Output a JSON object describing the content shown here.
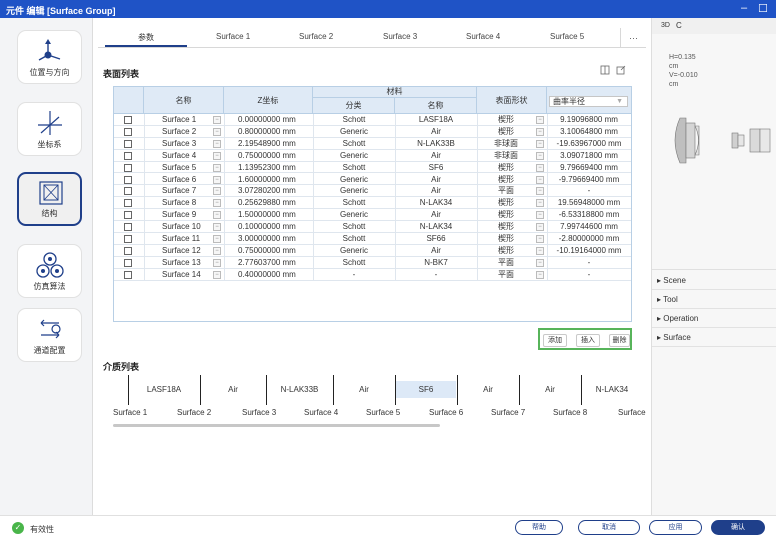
{
  "window": {
    "title": "元件 编辑 [Surface Group]",
    "minimize": "–",
    "restore": "☐"
  },
  "sidebar": {
    "items": [
      {
        "label": "位置与方向",
        "icon": "position-icon"
      },
      {
        "label": "坐标系",
        "icon": "coordinate-icon"
      },
      {
        "label": "结构",
        "icon": "structure-icon",
        "active": true
      },
      {
        "label": "仿真算法",
        "icon": "simulation-icon"
      },
      {
        "label": "通道配置",
        "icon": "channel-icon"
      }
    ]
  },
  "tabs": [
    "参数",
    "Surface 1",
    "Surface 2",
    "Surface 3",
    "Surface 4",
    "Surface 5"
  ],
  "tabs_more": "···",
  "surface_table": {
    "title": "表面列表",
    "headers": {
      "name": "名称",
      "z": "Z坐标",
      "material": "材料",
      "category": "分类",
      "material_name": "名称",
      "shape": "表面形状"
    },
    "radius_select": "曲率半径",
    "rows": [
      {
        "name": "Surface 1",
        "z": "0.00000000 mm",
        "category": "Schott",
        "material": "LASF18A",
        "shape": "楔形",
        "radius": "9.19096800 mm"
      },
      {
        "name": "Surface 2",
        "z": "0.80000000 mm",
        "category": "Generic",
        "material": "Air",
        "shape": "楔形",
        "radius": "3.10064800 mm"
      },
      {
        "name": "Surface 3",
        "z": "2.19548900 mm",
        "category": "Schott",
        "material": "N-LAK33B",
        "shape": "非球面",
        "radius": "-19.63967000 mm"
      },
      {
        "name": "Surface 4",
        "z": "0.75000000 mm",
        "category": "Generic",
        "material": "Air",
        "shape": "非球面",
        "radius": "3.09071800 mm"
      },
      {
        "name": "Surface 5",
        "z": "1.13952300 mm",
        "category": "Schott",
        "material": "SF6",
        "shape": "楔形",
        "radius": "9.79669400 mm"
      },
      {
        "name": "Surface 6",
        "z": "1.60000000 mm",
        "category": "Generic",
        "material": "Air",
        "shape": "楔形",
        "radius": "-9.79669400 mm"
      },
      {
        "name": "Surface 7",
        "z": "3.07280200 mm",
        "category": "Generic",
        "material": "Air",
        "shape": "平面",
        "radius": "-"
      },
      {
        "name": "Surface 8",
        "z": "0.25629880 mm",
        "category": "Schott",
        "material": "N-LAK34",
        "shape": "楔形",
        "radius": "19.56948000 mm"
      },
      {
        "name": "Surface 9",
        "z": "1.50000000 mm",
        "category": "Generic",
        "material": "Air",
        "shape": "楔形",
        "radius": "-6.53318800 mm"
      },
      {
        "name": "Surface 10",
        "z": "0.10000000 mm",
        "category": "Schott",
        "material": "N-LAK34",
        "shape": "楔形",
        "radius": "7.99744600 mm"
      },
      {
        "name": "Surface 11",
        "z": "3.00000000 mm",
        "category": "Schott",
        "material": "SF66",
        "shape": "楔形",
        "radius": "-2.80000000 mm"
      },
      {
        "name": "Surface 12",
        "z": "0.75000000 mm",
        "category": "Generic",
        "material": "Air",
        "shape": "楔形",
        "radius": "-10.19164000 mm"
      },
      {
        "name": "Surface 13",
        "z": "2.77603700 mm",
        "category": "Schott",
        "material": "N-BK7",
        "shape": "平面",
        "radius": "-"
      },
      {
        "name": "Surface 14",
        "z": "0.40000000 mm",
        "category": "-",
        "material": "-",
        "shape": "平面",
        "radius": "-"
      }
    ],
    "actions": {
      "add": "添加",
      "insert": "插入",
      "delete": "删除"
    }
  },
  "medium_list": {
    "title": "介质列表",
    "media": [
      "LASF18A",
      "Air",
      "N-LAK33B",
      "Air",
      "SF6",
      "Air",
      "Air",
      "N-LAK34"
    ],
    "surfaces": [
      "Surface 1",
      "Surface 2",
      "Surface 3",
      "Surface 4",
      "Surface 5",
      "Surface 6",
      "Surface 7",
      "Surface 8",
      "Surface"
    ]
  },
  "right_panel": {
    "view_label": "3D",
    "refresh": "C",
    "info": [
      "H=0.135",
      "cm",
      "V=-0.010",
      "cm"
    ],
    "sections": [
      "Scene",
      "Tool",
      "Operation",
      "Surface"
    ]
  },
  "status": {
    "validity": "有效性",
    "buttons": {
      "help": "帮助",
      "cancel": "取消",
      "apply": "应用",
      "confirm": "确认"
    }
  }
}
